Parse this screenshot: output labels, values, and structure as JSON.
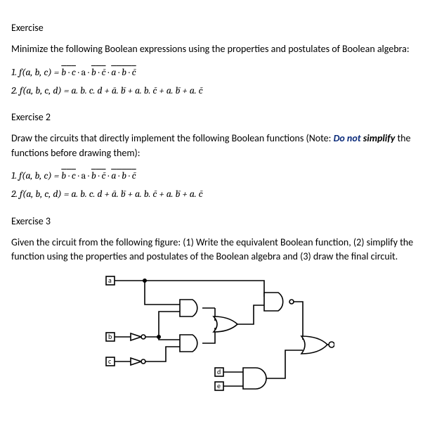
{
  "ex1": {
    "heading": "Exercise",
    "instruction": "Minimize the following Boolean expressions using the properties and postulates of Boolean algebra:",
    "f1_lead": "1. f(a, b, c) = ",
    "f1_t1a": "b",
    "f1_t1op": " · ",
    "f1_t1b": "c",
    "f1_mid1": " · a · ",
    "f1_t2a": "b",
    "f1_t2op": " · ",
    "f1_t2b": "c̄",
    "f1_mid2": " · ",
    "f1_t3a": "a",
    "f1_t3op": " · ",
    "f1_t3b": "b",
    "f1_t3op2": " · ",
    "f1_t3c": "c̄",
    "f2_lead": "2. f(a, b, c, d) = a. b. c. d + ā. b̄ + a. b. c̄ + a. b̄ + a. c̄"
  },
  "ex2": {
    "heading": "Exercise 2",
    "instr_a": "Draw the circuits that directly implement the following Boolean functions (Note: ",
    "instr_b": "Do not simplify",
    "instr_b1": "Do not",
    "instr_b2": "simplify",
    "instr_c": " the functions before drawing them):",
    "f1_lead": "1. f(a, b, c) = ",
    "f2_lead": "2. f(a, b, c, d) = a. b. c. d + ā. b̄ + a. b. c̄ + a. b̄ + a. c̄"
  },
  "ex3": {
    "heading": "Exercise 3",
    "instruction": "Given the circuit from the following figure: (1) Write the equivalent Boolean function, (2) simplify the function using the properties and postulates of the Boolean algebra and (3) draw the final circuit."
  },
  "circuit": {
    "labels": {
      "a": "a",
      "b": "b",
      "c": "c",
      "d": "d",
      "e": "e"
    }
  },
  "chart_data": {
    "type": "diagram",
    "description": "Logic circuit with inputs a,b,c,d,e. b and c each pass through a NOT gate. Input a and NOT(b) feed an AND gate. NOT(b) and NOT(c) feed another AND gate. Both AND outputs feed an OR gate. Input a and the OR output feed a NAND gate. Inputs d and e feed an AND gate. The NAND output and the d·e AND output feed a final OR gate producing the circuit output.",
    "inputs": [
      "a",
      "b",
      "c",
      "d",
      "e"
    ],
    "gates": [
      {
        "id": "not_b",
        "type": "NOT",
        "in": [
          "b"
        ]
      },
      {
        "id": "not_c",
        "type": "NOT",
        "in": [
          "c"
        ]
      },
      {
        "id": "and1",
        "type": "AND",
        "in": [
          "a",
          "not_b"
        ]
      },
      {
        "id": "and2",
        "type": "AND",
        "in": [
          "not_b",
          "not_c"
        ]
      },
      {
        "id": "or1",
        "type": "OR",
        "in": [
          "and1",
          "and2"
        ]
      },
      {
        "id": "nand1",
        "type": "NAND",
        "in": [
          "a",
          "or1"
        ]
      },
      {
        "id": "and3",
        "type": "AND",
        "in": [
          "d",
          "e"
        ]
      },
      {
        "id": "or2",
        "type": "OR",
        "in": [
          "nand1",
          "and3"
        ],
        "output": true
      }
    ]
  }
}
